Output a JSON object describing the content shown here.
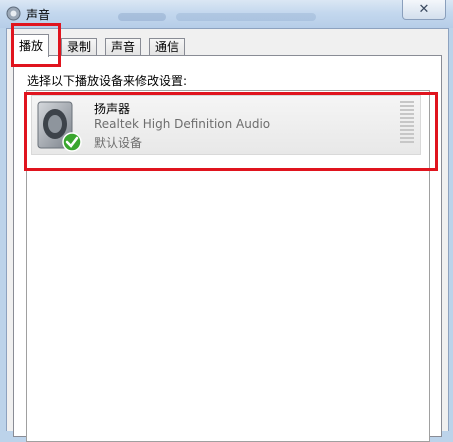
{
  "window": {
    "title": "声音",
    "close_symbol": "✕"
  },
  "tabs": [
    {
      "label": "播放",
      "active": true
    },
    {
      "label": "录制",
      "active": false
    },
    {
      "label": "声音",
      "active": false
    },
    {
      "label": "通信",
      "active": false
    }
  ],
  "panel": {
    "hint": "选择以下播放设备来修改设置:"
  },
  "device": {
    "name": "扬声器",
    "driver": "Realtek High Definition Audio",
    "status": "默认设备"
  },
  "colors": {
    "highlight": "#e0141e",
    "check": "#3aa62e"
  }
}
